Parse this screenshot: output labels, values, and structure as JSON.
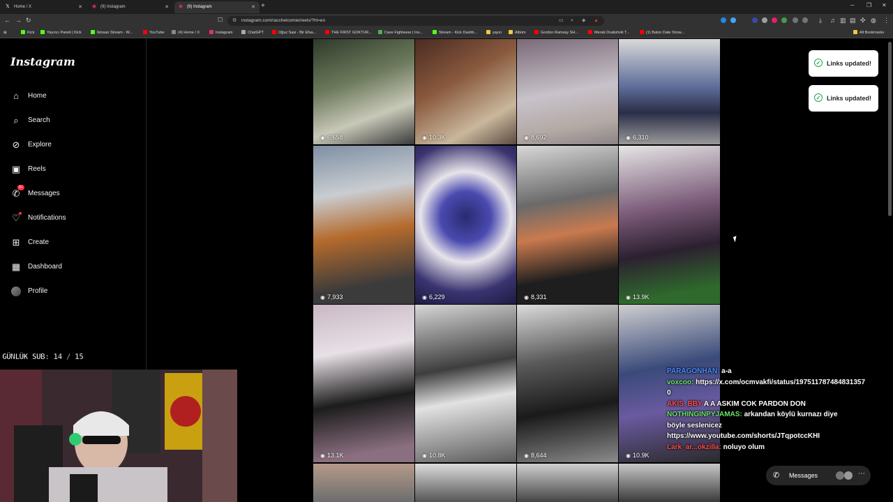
{
  "browser": {
    "tabs": [
      {
        "label": "Home / X",
        "icon": "x-icon"
      },
      {
        "label": "(9) Instagram",
        "icon": "instagram-icon"
      },
      {
        "label": "(9) Instagram",
        "icon": "instagram-icon",
        "active": true
      }
    ],
    "url": "instagram.com/racchelcomie/reels/?hl=en",
    "bookmarks": [
      "Kick",
      "Yayıncı Paneli | Kick",
      "İkinsan Stream - W...",
      "YouTube",
      "(4) Home / X",
      "Instagram",
      "ChatGPT",
      "Oğuz Sasi - Bir Efsa...",
      "THE FIRST GOKTUR...",
      "Cave Fightwear | Ins...",
      "Stream - Kick Dashb...",
      "yayın",
      "Albüm",
      "Gordon Ramsay SH...",
      "Merab Dvalishvili T...",
      "(1) Balon Date Show..."
    ],
    "all_bookmarks": "All Bookmarks"
  },
  "sidebar": {
    "logo": "Instagram",
    "items": [
      {
        "label": "Home",
        "icon": "home-icon"
      },
      {
        "label": "Search",
        "icon": "search-icon"
      },
      {
        "label": "Explore",
        "icon": "compass-icon"
      },
      {
        "label": "Reels",
        "icon": "reels-icon"
      },
      {
        "label": "Messages",
        "icon": "messenger-icon",
        "badge": "9+"
      },
      {
        "label": "Notifications",
        "icon": "heart-icon"
      },
      {
        "label": "Create",
        "icon": "plus-square-icon"
      },
      {
        "label": "Dashboard",
        "icon": "chart-icon"
      },
      {
        "label": "Profile",
        "icon": "avatar-icon"
      }
    ]
  },
  "reels": [
    {
      "views": "6,658"
    },
    {
      "views": "10.3K"
    },
    {
      "views": "8,692"
    },
    {
      "views": "6,310"
    },
    {
      "views": "7,933"
    },
    {
      "views": "6,229"
    },
    {
      "views": "8,331"
    },
    {
      "views": "13.9K"
    },
    {
      "views": "13.1K"
    },
    {
      "views": "10.8K"
    },
    {
      "views": "8,644"
    },
    {
      "views": "10.9K"
    }
  ],
  "toasts": [
    "Links updated!",
    "Links updated!"
  ],
  "overlay": {
    "sub_counter": "GÜNLÜK SUB: 14 / 15",
    "chat": [
      {
        "user": "PARAGONHAN:",
        "msg": " a-a",
        "color": "#4b8cff"
      },
      {
        "user": "voxcoo:",
        "msg": " https://x.com/ocmvakfi/status/197511787484831357",
        "color": "#6be36b"
      },
      {
        "user": "",
        "msg": "0",
        "color": "#ffffff"
      },
      {
        "user": "AKIS_BBY",
        "msg": " A A ASKIM COK PARDON DON",
        "color": "#ff4d4d"
      },
      {
        "user": "NOTHINGINPYJAMAS:",
        "msg": " arkandan köylü kurnazı diye",
        "color": "#6be36b"
      },
      {
        "user": "",
        "msg": "böyle seslenicez",
        "color": "#ffffff"
      },
      {
        "user": "",
        "msg": "https://www.youtube.com/shorts/JTqpotccKHI",
        "color": "#ffffff"
      },
      {
        "user": "Lark_ar...okzilla:",
        "msg": " noluyo olum",
        "color": "#ff4d4d"
      }
    ],
    "messages_pill": "Messages"
  }
}
